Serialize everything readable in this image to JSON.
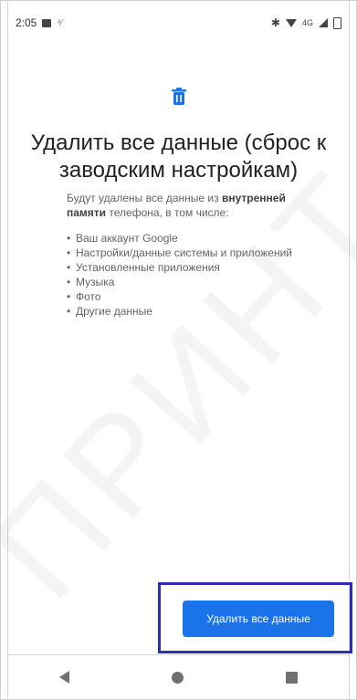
{
  "status_bar": {
    "time": "2:05",
    "lte_label": "4G"
  },
  "screen": {
    "title": "Удалить все данные (сброс к заводским настройкам)",
    "description_part1": "Будут удалены все данные из",
    "description_bold": "внутренней памяти",
    "description_part2": "телефона, в том числе:",
    "items": [
      "Ваш аккаунт Google",
      "Настройки/данные системы и приложений",
      "Установленные приложения",
      "Музыка",
      "Фото",
      "Другие данные"
    ],
    "wipe_button_label": "Удалить все данные"
  },
  "watermark": "ПРИНТ",
  "colors": {
    "accent": "#1a73e8",
    "highlight_border": "#2f2db8"
  },
  "icons": {
    "header_icon": "trash-icon"
  }
}
